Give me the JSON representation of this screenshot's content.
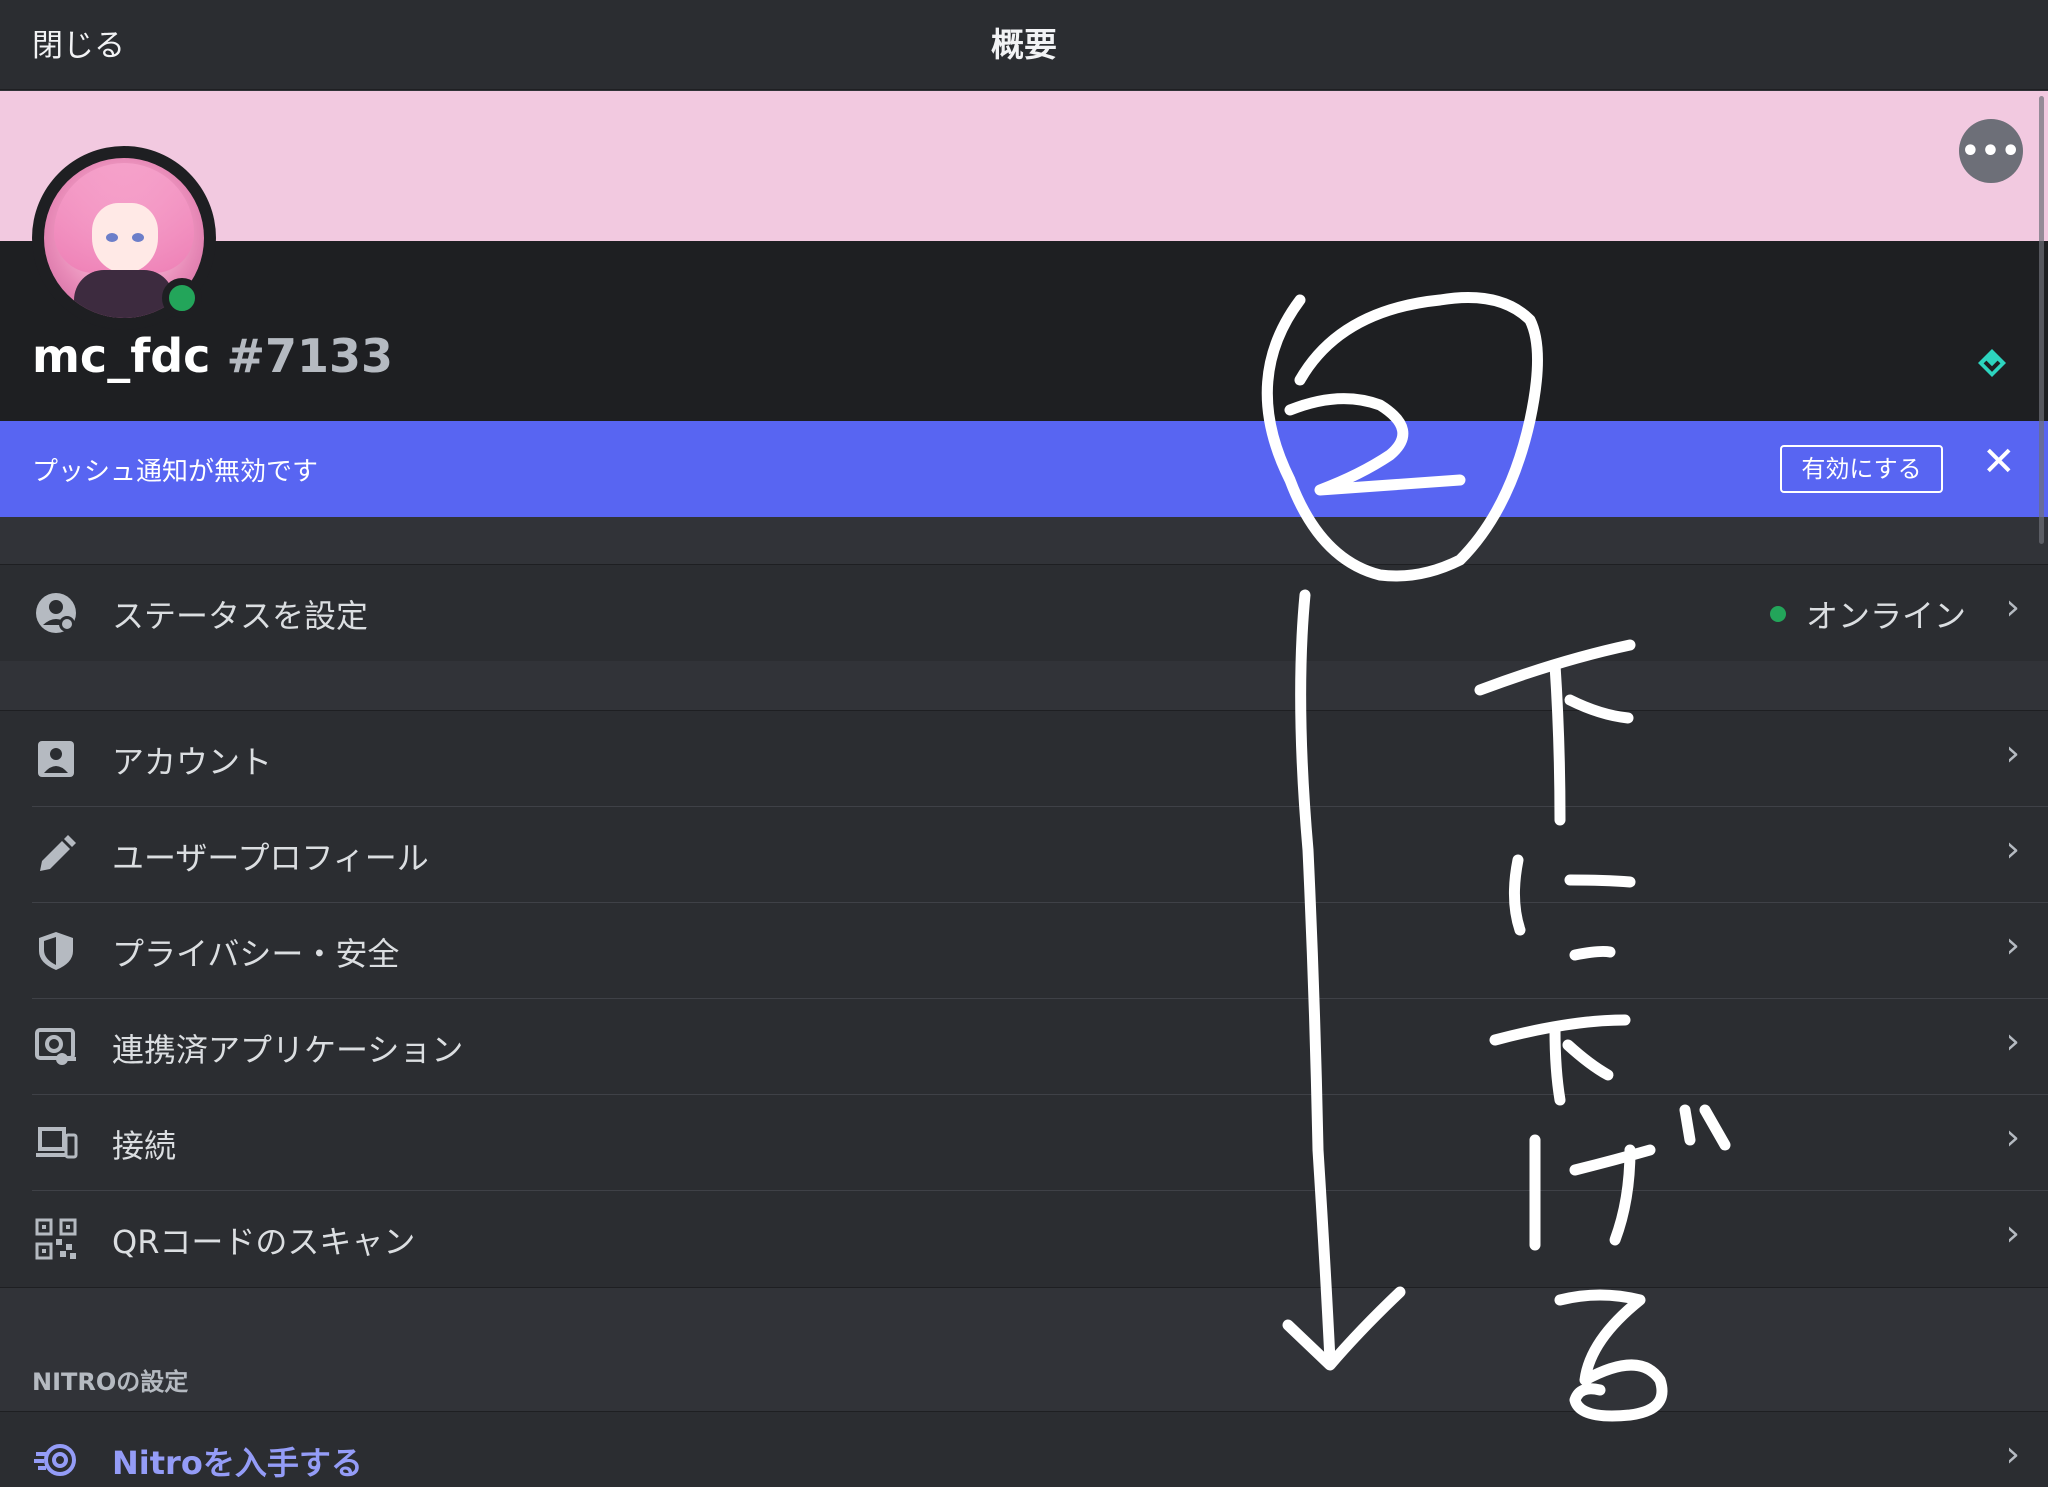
{
  "topbar": {
    "close_label": "閉じる",
    "title": "概要"
  },
  "banner": {
    "color": "#f2c9e0",
    "more_icon": "more-horizontal-icon",
    "more_glyph": "•••"
  },
  "profile": {
    "username": "mc_fdc",
    "discriminator": "#7133",
    "status": "online",
    "status_color": "#23a55a",
    "badge_icon": "nitro-diamond-icon"
  },
  "notice": {
    "text": "プッシュ通知が無効です",
    "enable_label": "有効にする",
    "dismiss_glyph": "✕",
    "color": "#5865f2"
  },
  "status_row": {
    "label": "ステータスを設定",
    "value": "オンライン",
    "icon": "status-icon"
  },
  "account_rows": [
    {
      "label": "アカウント",
      "icon": "account-icon"
    },
    {
      "label": "ユーザープロフィール",
      "icon": "pencil-icon"
    },
    {
      "label": "プライバシー・安全",
      "icon": "shield-icon"
    },
    {
      "label": "連携済アプリケーション",
      "icon": "authorized-apps-icon"
    },
    {
      "label": "接続",
      "icon": "devices-icon"
    },
    {
      "label": "QRコードのスキャン",
      "icon": "qr-code-icon"
    }
  ],
  "nitro_section": {
    "header": "NITROの設定",
    "row_label": "Nitroを入手する",
    "icon": "nitro-icon",
    "accent": "#949cf7"
  },
  "chevron_glyph": "›",
  "annotation": {
    "circled_number": "2",
    "handwritten_text": "下に下げる",
    "arrow": "down-arrow"
  }
}
